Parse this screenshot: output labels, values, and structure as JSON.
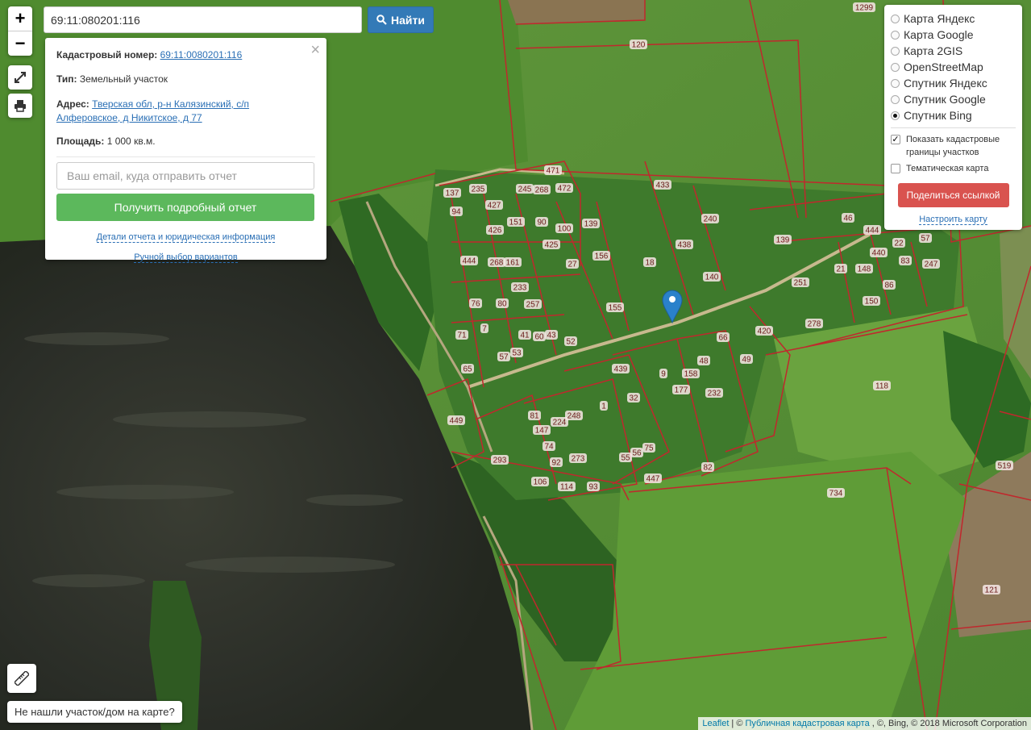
{
  "search": {
    "value": "69:11:080201:116",
    "button_label": "Найти"
  },
  "zoom": {
    "plus": "+",
    "minus": "−"
  },
  "popup": {
    "cadastral_label": "Кадастровый номер:",
    "cadastral_value": "69:11:0080201:116",
    "type_label": "Тип:",
    "type_value": "Земельный участок",
    "address_label": "Адрес:",
    "address_line1": "Тверская обл, р-н Калязинский, с/п",
    "address_line2": "Алферовское, д Никитское, д 77",
    "area_label": "Площадь:",
    "area_value": "1 000 кв.м.",
    "email_placeholder": "Ваш email, куда отправить отчет",
    "report_button": "Получить подробный отчет",
    "details_link": "Детали отчета и юридическая информация",
    "manual_link": "Ручной выбор вариантов"
  },
  "layers": {
    "items": [
      {
        "label": "Карта Яндекс",
        "selected": false
      },
      {
        "label": "Карта Google",
        "selected": false
      },
      {
        "label": "Карта 2GIS",
        "selected": false
      },
      {
        "label": "OpenStreetMap",
        "selected": false
      },
      {
        "label": "Спутник Яндекс",
        "selected": false
      },
      {
        "label": "Спутник Google",
        "selected": false
      },
      {
        "label": "Спутник Bing",
        "selected": true
      }
    ],
    "show_cadastral": "Показать кадастровые границы участков",
    "show_cadastral_checked": true,
    "thematic": "Тематическая карта",
    "thematic_checked": false,
    "share_button": "Поделиться ссылкой",
    "settings_link": "Настроить карту"
  },
  "not_found_button": "Не нашли участок/дом на карте?",
  "attribution": {
    "leaflet": "Leaflet",
    "sep1": "| ©",
    "pkk": "Публичная кадастровая карта",
    "rest": ", ©, Bing, © 2018 Microsoft Corporation"
  },
  "parcel_labels": [
    "1299",
    "120",
    "137",
    "235",
    "427",
    "245",
    "268",
    "471",
    "472",
    "433",
    "94",
    "426",
    "151",
    "90",
    "100",
    "139",
    "240",
    "438",
    "444",
    "268",
    "161",
    "425",
    "27",
    "156",
    "18",
    "140",
    "76",
    "233",
    "80",
    "257",
    "155",
    "7",
    "71",
    "41",
    "60",
    "43",
    "52",
    "65",
    "57",
    "53",
    "439",
    "9",
    "158",
    "177",
    "232",
    "46",
    "444",
    "139",
    "440",
    "22",
    "57",
    "21",
    "148",
    "83",
    "247",
    "251",
    "86",
    "150",
    "278",
    "420",
    "66",
    "49",
    "48",
    "118",
    "449",
    "81",
    "147",
    "224",
    "248",
    "1",
    "32",
    "74",
    "92",
    "273",
    "56",
    "55",
    "75",
    "447",
    "82",
    "106",
    "114",
    "93",
    "293",
    "734",
    "519",
    "121"
  ],
  "colors": {
    "parcel_border": "#c0282d",
    "label_bg": "#f7e8e6",
    "search_button": "#337ab7",
    "report_button": "#5cb85c",
    "share_button": "#d9534f",
    "marker": "#2a81cb"
  }
}
